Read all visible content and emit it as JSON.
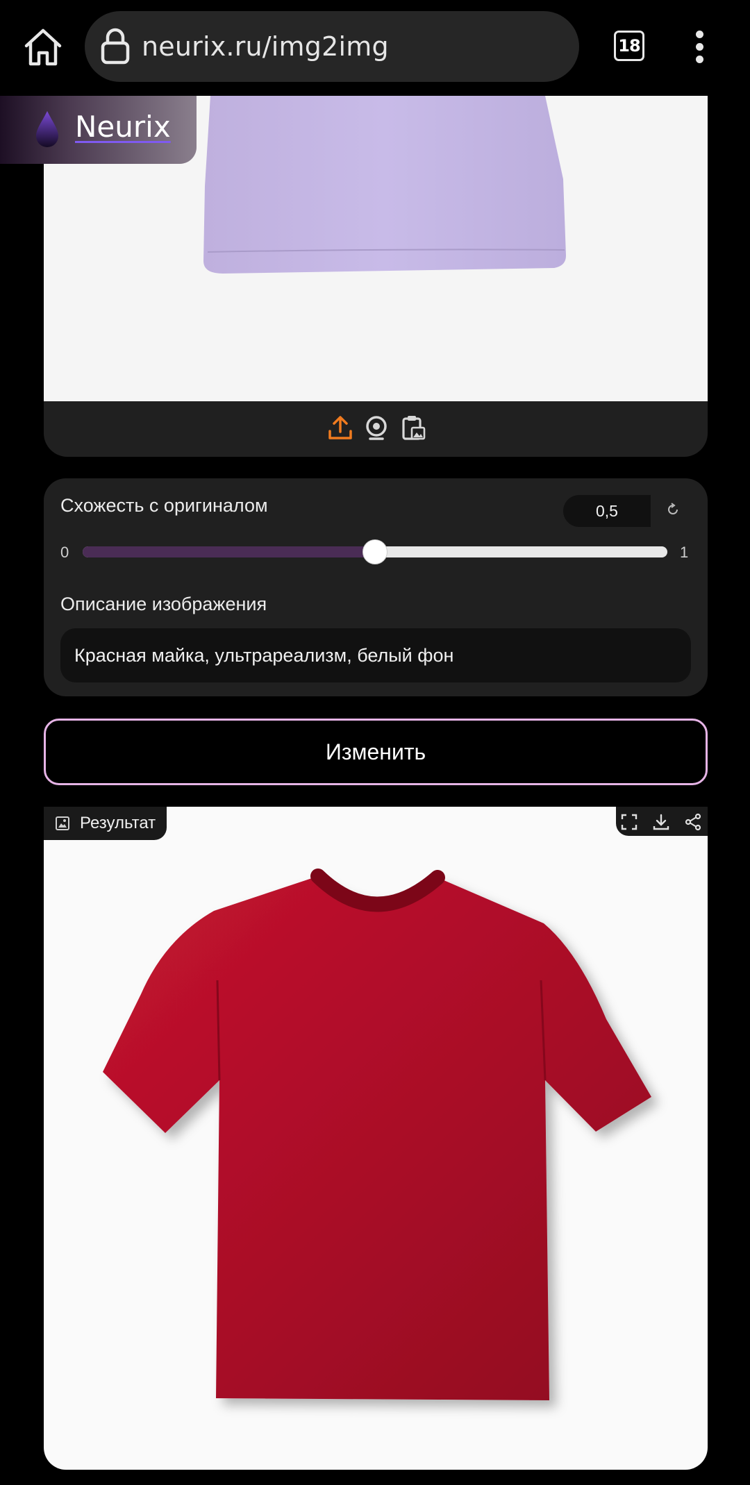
{
  "browser": {
    "url": "neurix.ru/img2img",
    "tab_count": "18"
  },
  "logo": {
    "text": "Neurix"
  },
  "upload": {
    "tools": [
      "upload-icon",
      "webcam-icon",
      "clipboard-icon"
    ],
    "accent_color": "#f07b1f"
  },
  "settings": {
    "similarity_label": "Схожесть с оригиналом",
    "similarity_value": "0,5",
    "slider_min": "0",
    "slider_max": "1",
    "slider_level": 0.5,
    "description_label": "Описание изображения",
    "description_value": "Красная майка, ультрареализм, белый фон"
  },
  "submit": {
    "label": "Изменить",
    "border_color": "#e6b4e6"
  },
  "result": {
    "label": "Результат",
    "actions": [
      "fullscreen-icon",
      "download-icon",
      "share-icon"
    ],
    "shirt_color": "#b8102e"
  },
  "colors": {
    "slider_fill": "#4a2c55",
    "shirt_original": "#c7b8e6"
  }
}
